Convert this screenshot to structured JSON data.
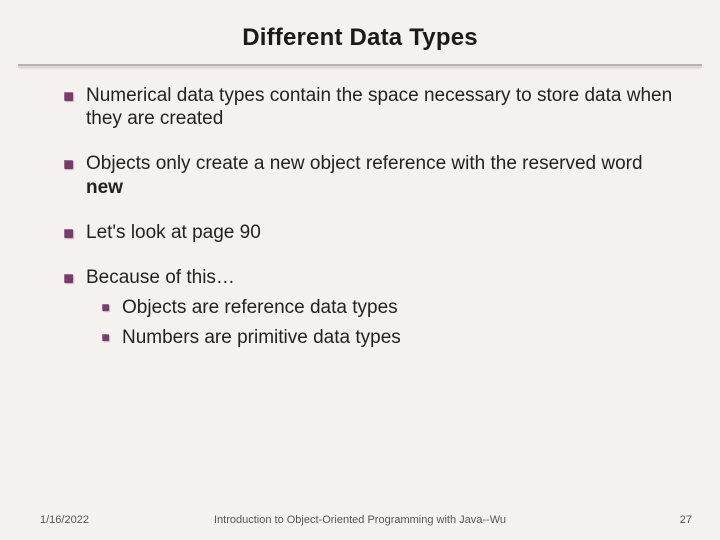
{
  "title": "Different Data Types",
  "bullets": {
    "b1": "Numerical data types contain the space necessary to store data when they are created",
    "b2_pre": "Objects only create a new object reference with the reserved word ",
    "b2_bold": "new",
    "b3": "Let's look at page 90",
    "b4": "Because of this…",
    "b4_sub1": "Objects are reference data types",
    "b4_sub2": "Numbers are primitive data types"
  },
  "footer": {
    "date": "1/16/2022",
    "center": "Introduction to Object-Oriented Programming with Java--Wu",
    "page": "27"
  }
}
